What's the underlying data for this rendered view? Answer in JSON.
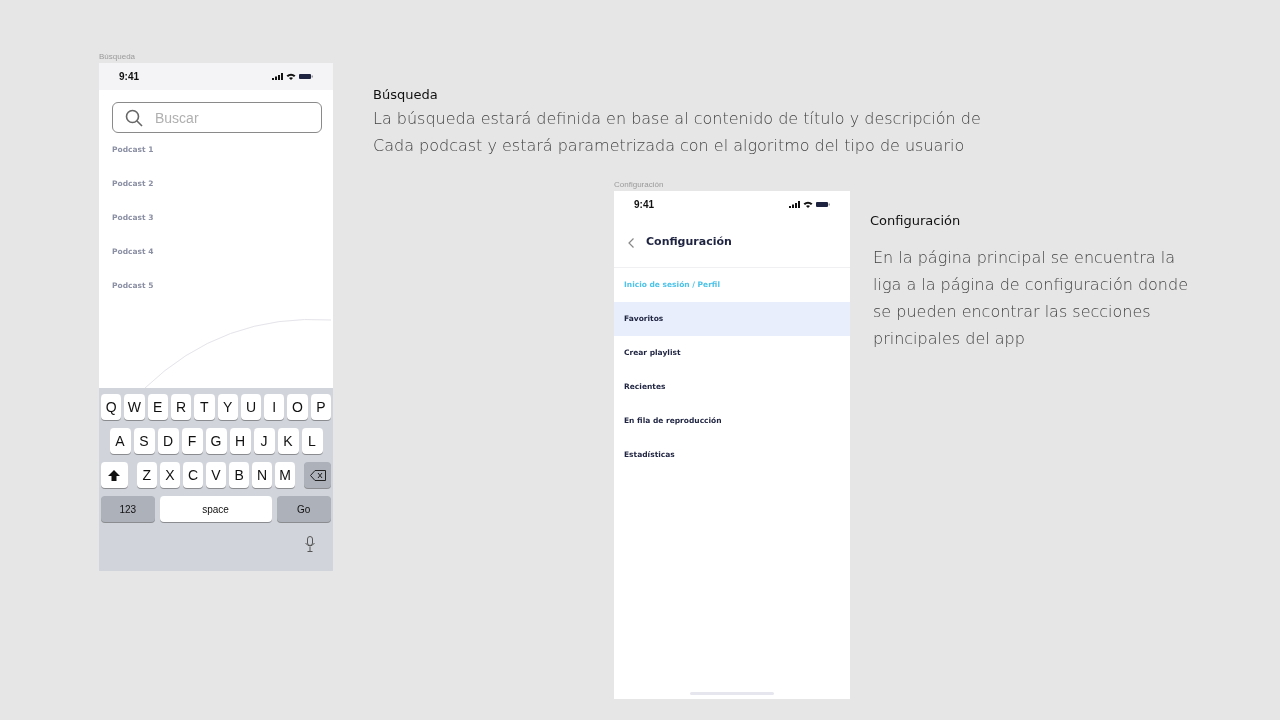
{
  "search_screen": {
    "caption": "Búsqueda",
    "status_time": "9:41",
    "search": {
      "placeholder": "Buscar"
    },
    "results": [
      "Podcast 1",
      "Podcast 2",
      "Podcast 3",
      "Podcast 4",
      "Podcast 5"
    ],
    "keyboard": {
      "rows": [
        [
          "Q",
          "W",
          "E",
          "R",
          "T",
          "Y",
          "U",
          "I",
          "O",
          "P"
        ],
        [
          "A",
          "S",
          "D",
          "F",
          "G",
          "H",
          "J",
          "K",
          "L"
        ],
        [
          "Z",
          "X",
          "C",
          "V",
          "B",
          "N",
          "M"
        ]
      ],
      "number_key": "123",
      "space_key": "space",
      "go_key": "Go"
    }
  },
  "search_note": {
    "title": "Búsqueda",
    "text": "La búsqueda estará definida en base al contenido de título y descripción de Cada podcast y estará parametrizada con el algoritmo del tipo de usuario"
  },
  "settings_screen": {
    "caption": "Configuración",
    "status_time": "9:41",
    "title": "Configuración",
    "items": [
      {
        "label": "Inicio de sesión / Perfil",
        "kind": "link",
        "selected": false
      },
      {
        "label": "Favoritos",
        "kind": "item",
        "selected": true
      },
      {
        "label": "Crear playlist",
        "kind": "item",
        "selected": false
      },
      {
        "label": "Recientes",
        "kind": "item",
        "selected": false
      },
      {
        "label": "En fila de reproducción",
        "kind": "item",
        "selected": false
      },
      {
        "label": "Estadísticas",
        "kind": "item",
        "selected": false
      }
    ]
  },
  "settings_note": {
    "title": "Configuración",
    "text": "En la página principal se encuentra la liga a la página de configuración donde se pueden encontrar las secciones principales del app"
  }
}
